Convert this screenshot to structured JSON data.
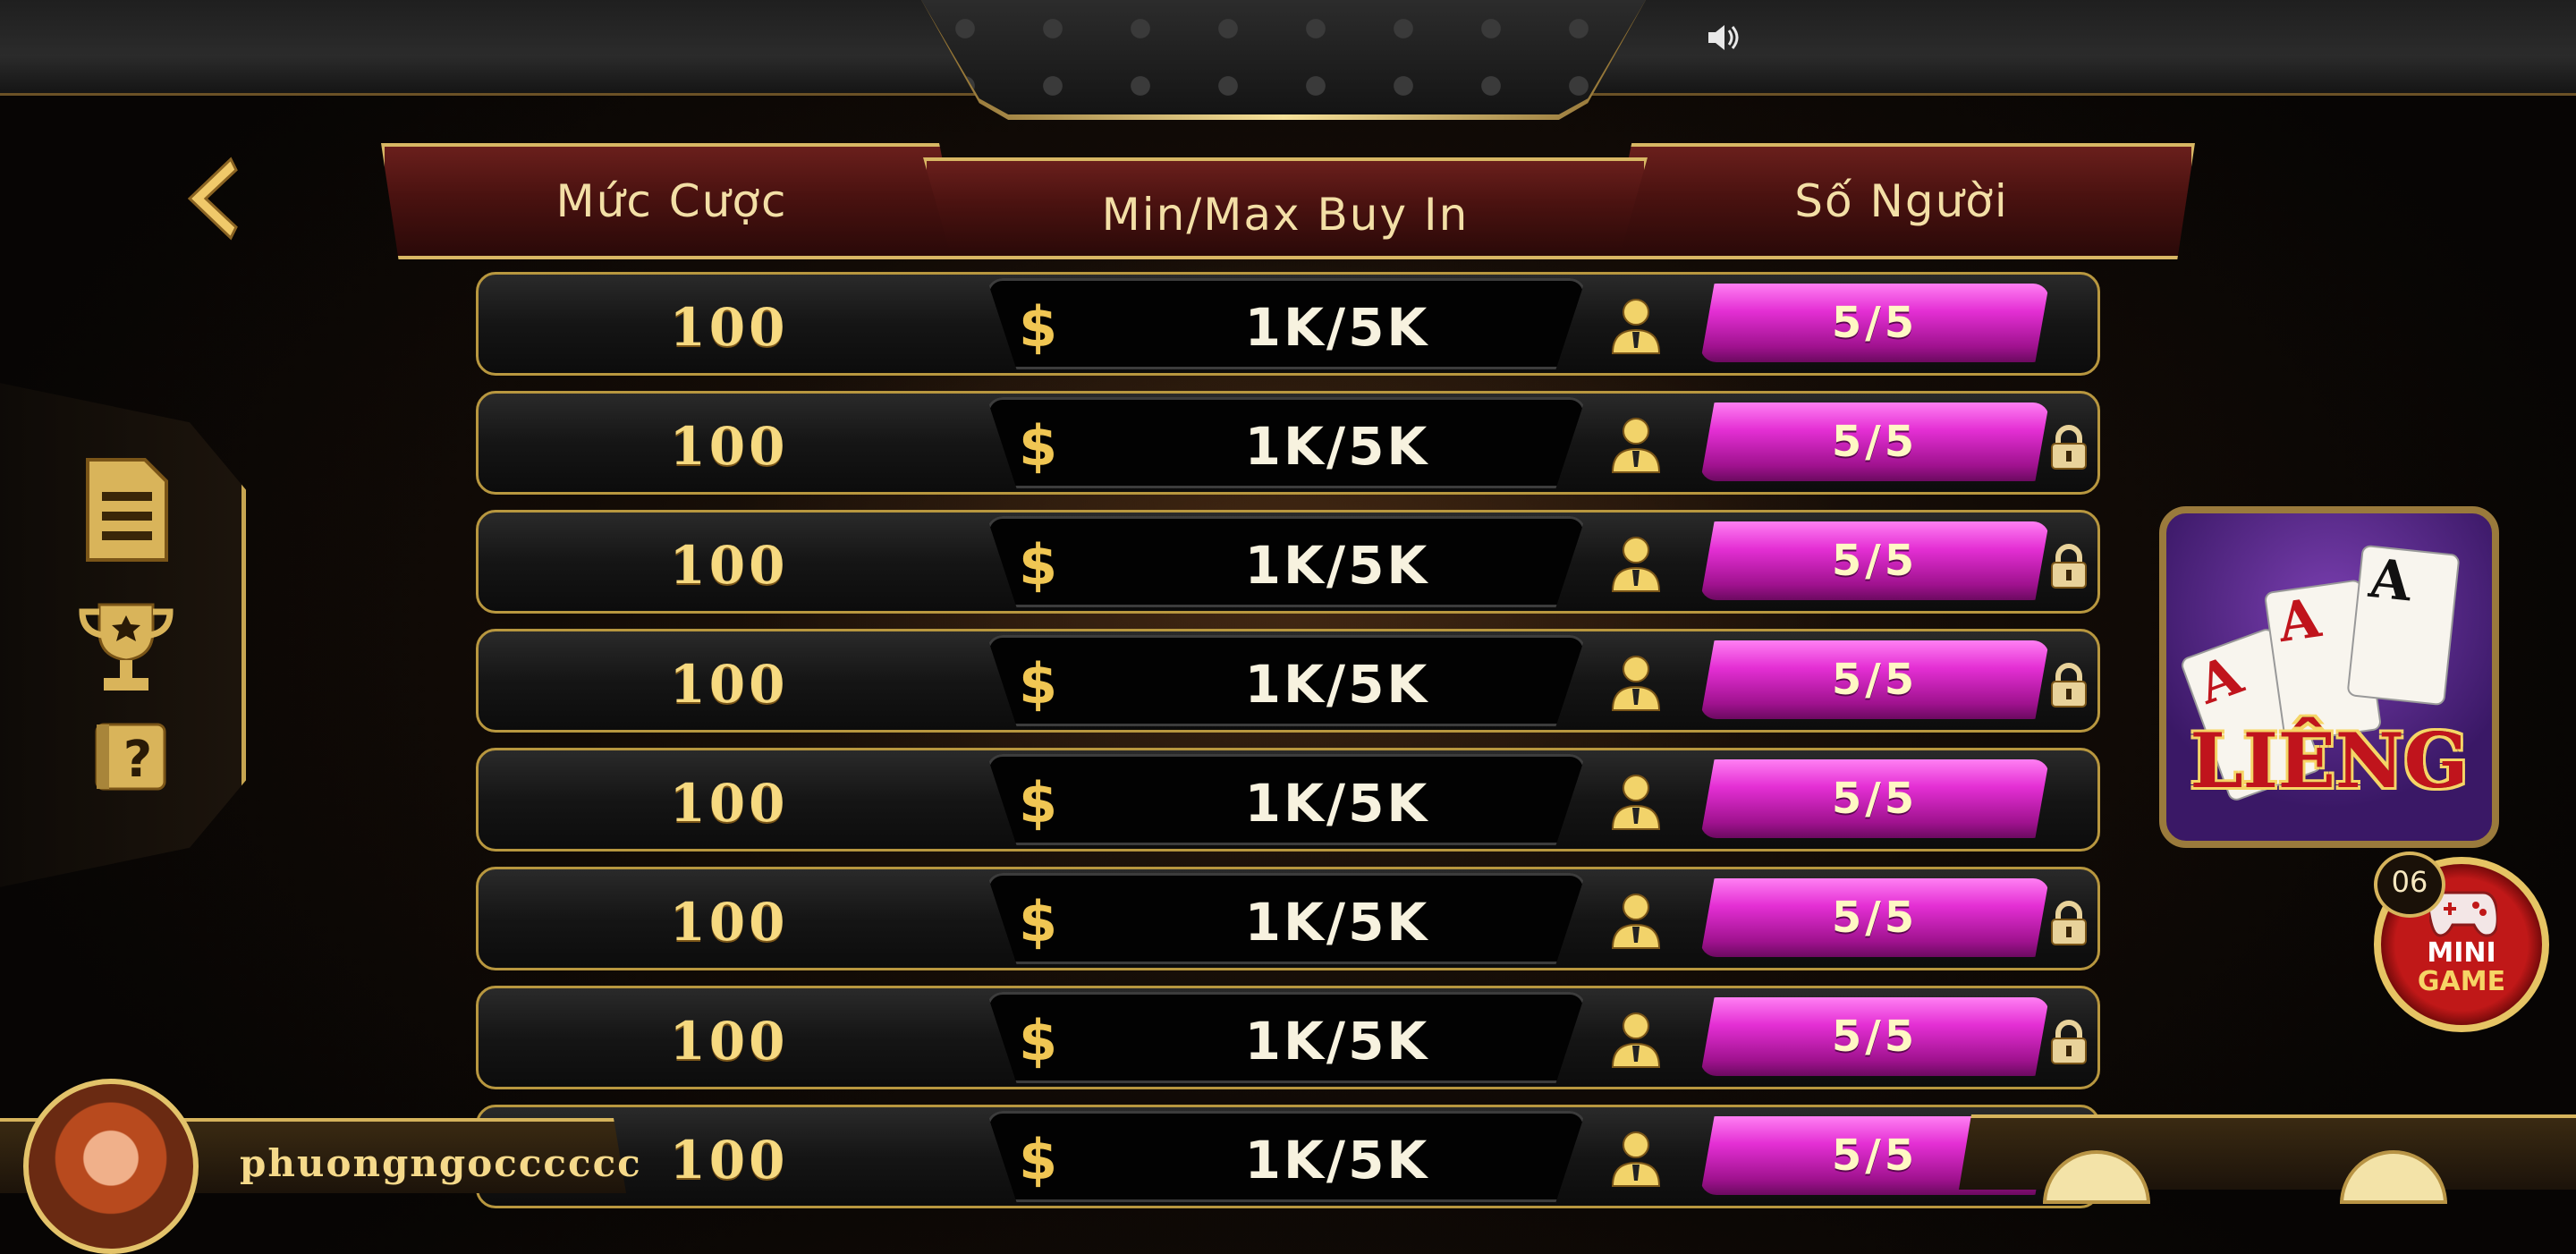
{
  "header": {
    "bet_label": "Mức Cược",
    "buyin_label": "Min/Max Buy In",
    "players_label": "Số Người"
  },
  "rooms": [
    {
      "bet": "100",
      "currency": "$",
      "buyin": "1K/5K",
      "players": "5/5",
      "locked": false
    },
    {
      "bet": "100",
      "currency": "$",
      "buyin": "1K/5K",
      "players": "5/5",
      "locked": true
    },
    {
      "bet": "100",
      "currency": "$",
      "buyin": "1K/5K",
      "players": "5/5",
      "locked": true
    },
    {
      "bet": "100",
      "currency": "$",
      "buyin": "1K/5K",
      "players": "5/5",
      "locked": true
    },
    {
      "bet": "100",
      "currency": "$",
      "buyin": "1K/5K",
      "players": "5/5",
      "locked": false
    },
    {
      "bet": "100",
      "currency": "$",
      "buyin": "1K/5K",
      "players": "5/5",
      "locked": true
    },
    {
      "bet": "100",
      "currency": "$",
      "buyin": "1K/5K",
      "players": "5/5",
      "locked": true
    },
    {
      "bet": "100",
      "currency": "$",
      "buyin": "1K/5K",
      "players": "5/5",
      "locked": false
    }
  ],
  "game_logo": {
    "title": "LIÊNG",
    "card_rank": "A"
  },
  "minigame": {
    "badge": "06",
    "line1": "MINI",
    "line2": "GAME"
  },
  "user": {
    "username": "phuongngocccccc"
  },
  "colors": {
    "accent_gold": "#d8b764",
    "pill_magenta": "#e42fd4",
    "header_red": "#4a1210"
  },
  "icons": {
    "back": "chevron-left-icon",
    "sound": "speaker-icon",
    "side": [
      "document-icon",
      "trophy-icon",
      "help-icon"
    ],
    "player": "person-icon",
    "lock": "lock-icon"
  }
}
